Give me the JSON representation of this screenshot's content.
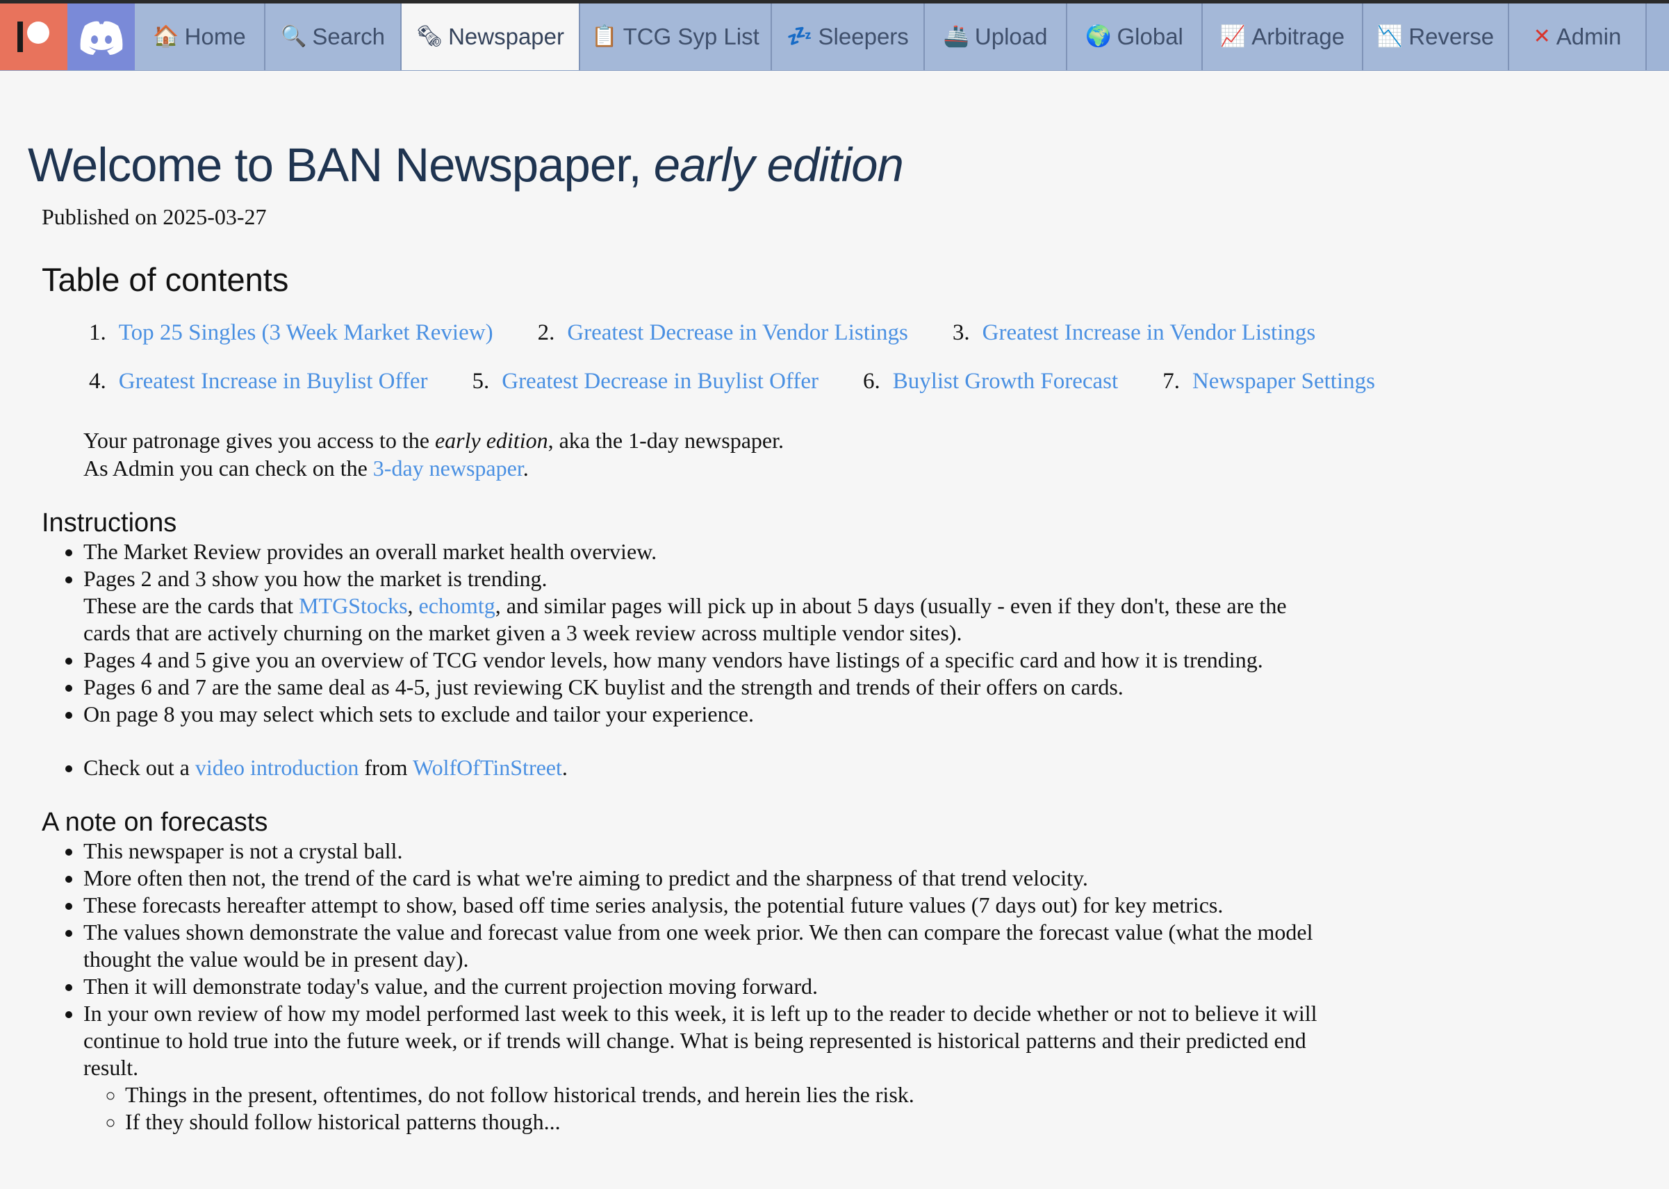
{
  "nav": {
    "tabs": [
      {
        "label": "Home",
        "icon": "🏠"
      },
      {
        "label": "Search",
        "icon": "🔍"
      },
      {
        "label": "Newspaper",
        "icon": "🗞"
      },
      {
        "label": "TCG Syp List",
        "icon": "📋"
      },
      {
        "label": "Sleepers",
        "icon": "💤"
      },
      {
        "label": "Upload",
        "icon": "🚢"
      },
      {
        "label": "Global",
        "icon": "🌍"
      },
      {
        "label": "Arbitrage",
        "icon": "📈"
      },
      {
        "label": "Reverse",
        "icon": "📉"
      },
      {
        "label": "Admin",
        "icon": "✕"
      }
    ]
  },
  "header": {
    "title": "Welcome to BAN Newspaper, ",
    "title_em": "early edition",
    "published": "Published on 2025-03-27"
  },
  "toc": {
    "heading": "Table of contents",
    "items": [
      {
        "num": "1.",
        "label": "Top 25 Singles (3 Week Market Review)"
      },
      {
        "num": "2.",
        "label": "Greatest Decrease in Vendor Listings"
      },
      {
        "num": "3.",
        "label": "Greatest Increase in Vendor Listings"
      },
      {
        "num": "4.",
        "label": "Greatest Increase in Buylist Offer"
      },
      {
        "num": "5.",
        "label": "Greatest Decrease in Buylist Offer"
      },
      {
        "num": "6.",
        "label": "Buylist Growth Forecast"
      },
      {
        "num": "7.",
        "label": "Newspaper Settings"
      }
    ]
  },
  "patron": {
    "line1_a": "Your patronage gives you access to the ",
    "line1_em": "early edition",
    "line1_b": ", aka the 1-day newspaper.",
    "line2_a": "As Admin you can check on the ",
    "line2_link": "3-day newspaper",
    "line2_b": "."
  },
  "instructions": {
    "heading": "Instructions",
    "i1": "The Market Review provides an overall market health overview.",
    "i2_a": "Pages 2 and 3 show you how the market is trending.",
    "i2_b": "These are the cards that ",
    "i2_link1": "MTGStocks",
    "i2_sep": ", ",
    "i2_link2": "echomtg",
    "i2_c": ", and similar pages will pick up in about 5 days (usually - even if they don't, these are the cards that are actively churning on the market given a 3 week review across multiple vendor sites).",
    "i3": "Pages 4 and 5 give you an overview of TCG vendor levels, how many vendors have listings of a specific card and how it is trending.",
    "i4": "Pages 6 and 7 are the same deal as 4-5, just reviewing CK buylist and the strength and trends of their offers on cards.",
    "i5": "On page 8 you may select which sets to exclude and tailor your experience.",
    "i6_a": "Check out a ",
    "i6_link1": "video introduction",
    "i6_b": " from ",
    "i6_link2": "WolfOfTinStreet",
    "i6_c": "."
  },
  "forecasts": {
    "heading": "A note on forecasts",
    "f1": "This newspaper is not a crystal ball.",
    "f2": "More often then not, the trend of the card is what we're aiming to predict and the sharpness of that trend velocity.",
    "f3": "These forecasts hereafter attempt to show, based off time series analysis, the potential future values (7 days out) for key metrics.",
    "f4": "The values shown demonstrate the value and forecast value from one week prior. We then can compare the forecast value (what the model thought the value would be in present day).",
    "f5": "Then it will demonstrate today's value, and the current projection moving forward.",
    "f6": "In your own review of how my model performed last week to this week, it is left up to the reader to decide whether or not to believe it will continue to hold true into the future week, or if trends will change. What is being represented is historical patterns and their predicted end result.",
    "f6_s1": "Things in the present, oftentimes, do not follow historical trends, and herein lies the risk.",
    "f6_s2": "If they should follow historical patterns though..."
  }
}
